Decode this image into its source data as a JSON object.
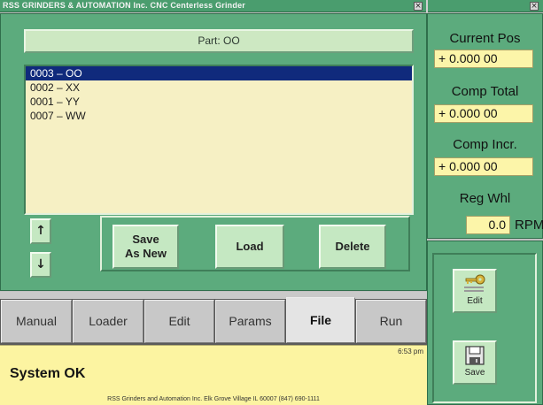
{
  "window": {
    "title": "RSS GRINDERS & AUTOMATION Inc. CNC Centerless Grinder",
    "close_glyph": "×"
  },
  "part": {
    "label": "Part: OO"
  },
  "programs": [
    {
      "label": "0003 – OO",
      "selected": true
    },
    {
      "label": "0002 – XX",
      "selected": false
    },
    {
      "label": "0001 – YY",
      "selected": false
    },
    {
      "label": "0007 – WW",
      "selected": false
    }
  ],
  "scroll": {
    "up_glyph": "↑",
    "down_glyph": "↓"
  },
  "actions": {
    "save_as_new_line1": "Save",
    "save_as_new_line2": "As New",
    "load": "Load",
    "delete": "Delete"
  },
  "side": {
    "current_pos_label": "Current Pos",
    "current_pos_value": "+ 0.000 00",
    "comp_total_label": "Comp Total",
    "comp_total_value": "+ 0.000 00",
    "comp_incr_label": "Comp Incr.",
    "comp_incr_value": "+ 0.000 00",
    "reg_whl_label": "Reg Whl",
    "reg_whl_value": "0.0",
    "reg_whl_unit": "RPM",
    "edit_button": "Edit",
    "save_button": "Save",
    "edit_icon": "key-icon",
    "save_icon": "floppy-disk-icon"
  },
  "tabs": [
    {
      "label": "Manual",
      "active": false
    },
    {
      "label": "Loader",
      "active": false
    },
    {
      "label": "Edit",
      "active": false
    },
    {
      "label": "Params",
      "active": false
    },
    {
      "label": "File",
      "active": true
    },
    {
      "label": "Run",
      "active": false
    }
  ],
  "status": {
    "time": "6:53 pm",
    "message": "System OK",
    "footer": "RSS Grinders and Automation Inc. Elk Grove Village IL 60007 (847) 690-1111"
  },
  "colors": {
    "panel_green": "#5cab7d",
    "title_green": "#4a9d6e",
    "button_green": "#c5e8c2",
    "list_background": "#f6f0c4",
    "selection_blue": "#102a7c",
    "status_yellow": "#fcf4a1",
    "value_yellow": "#fcf5a9"
  }
}
